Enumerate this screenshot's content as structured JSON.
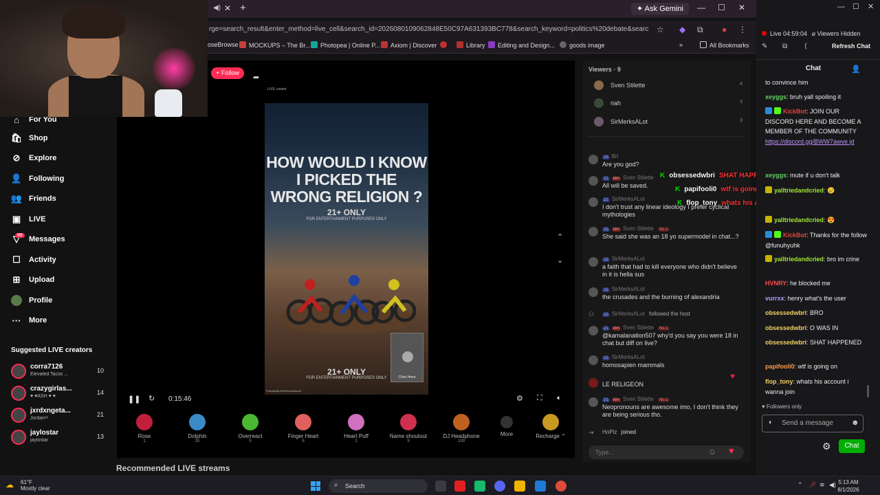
{
  "browser": {
    "url": "rge=search_result&enter_method=live_cell&search_id=2026080109062848E50C97A631393BC778&search_keyword=politics%20debate&search_result_id=…",
    "ask_gemini": "Ask Gemini",
    "bookmarks": [
      {
        "label": "oseBrowse",
        "color": "#444"
      },
      {
        "label": "MOCKUPS – The Br...",
        "color": "#c24040"
      },
      {
        "label": "Photopea | Online P...",
        "color": "#18a497"
      },
      {
        "label": "Axiom | Discover",
        "color": "#b83434"
      },
      {
        "label": "",
        "color": "#c03030"
      },
      {
        "label": "Library",
        "color": "#b03030"
      },
      {
        "label": "Editing and Design...",
        "color": "#8a3cc4"
      },
      {
        "label": "goods image",
        "color": "#666"
      }
    ],
    "all_bookmarks": "All Bookmarks"
  },
  "nav": {
    "items": [
      {
        "label": "For You",
        "icon": "home-icon"
      },
      {
        "label": "Shop",
        "icon": "shop-icon"
      },
      {
        "label": "Explore",
        "icon": "compass-icon"
      },
      {
        "label": "Following",
        "icon": "following-icon"
      },
      {
        "label": "Friends",
        "icon": "friends-icon"
      },
      {
        "label": "LIVE",
        "icon": "live-icon"
      },
      {
        "label": "Messages",
        "icon": "messages-icon"
      },
      {
        "label": "Activity",
        "icon": "activity-icon"
      },
      {
        "label": "Upload",
        "icon": "upload-icon"
      },
      {
        "label": "Profile",
        "icon": "profile-icon"
      },
      {
        "label": "More",
        "icon": "more-icon"
      }
    ],
    "messages_badge": "88",
    "suggested_title": "Suggested LIVE creators",
    "creators": [
      {
        "name": "corra7126",
        "sub": "Elevated Tacos ...",
        "count": "10"
      },
      {
        "name": "crazygirlas...",
        "sub": "♥ ♥ASH ♥ ♥",
        "count": "14"
      },
      {
        "name": "jxrdxngeta...",
        "sub": "Jxrdanᵛᵃ",
        "count": "21"
      },
      {
        "name": "jaylostar",
        "sub": "jaylostar",
        "count": "13"
      }
    ]
  },
  "live": {
    "follow": "+ Follow",
    "top_label": "LIVE creator",
    "title": "HOW WOULD I KNOW I PICKED THE WRONG RELIGION ?",
    "age_note": "21+ ONLY",
    "disclaimer": "FOR ENTERTAINMENT PURPOSES ONLY",
    "age_note_bottom": "21+ ONLY",
    "disclaimer_bottom": "FOR ENTERTAINMENT PURPOSES ONLY",
    "guest_name": "Chris Hmm",
    "watermark": "ProbablyButYesProductions1",
    "time": "0:15:46",
    "recommended": "Recommended LIVE streams"
  },
  "gifts": [
    {
      "name": "Rose",
      "price": "1",
      "color": "#c0203a"
    },
    {
      "name": "Dolphin",
      "price": "10",
      "color": "#3a8ac8"
    },
    {
      "name": "Overreact",
      "price": "5",
      "color": "#4ab830"
    },
    {
      "name": "Finger Heart",
      "price": "5",
      "color": "#e06060"
    },
    {
      "name": "Heart Puff",
      "price": "1",
      "color": "#d070c0"
    },
    {
      "name": "Name shoutout",
      "price": "5",
      "color": "#d03050"
    },
    {
      "name": "DJ Headphone",
      "price": "100",
      "color": "#c06020"
    }
  ],
  "gift_more": "More",
  "recharge": "Recharge ⌃",
  "viewers": {
    "title": "Viewers · 9",
    "list": [
      {
        "name": "Sven Stilette",
        "count": "4"
      },
      {
        "name": "riah",
        "count": "3"
      },
      {
        "name": "SirMerksALot",
        "count": "3"
      }
    ]
  },
  "live_chat": [
    {
      "level": "23",
      "user": "Bri",
      "text": "Are you god?"
    },
    {
      "level": "21",
      "tag": "klm",
      "user": "Sven Stilette",
      "text": "All will be saved."
    },
    {
      "level": "22",
      "user": "SirMerksALot",
      "text": "I don't trust any linear ideology I prefer cyclical mythologies"
    },
    {
      "level": "21",
      "tag": "klm",
      "user": "Sven Stilette",
      "rank": "No.1",
      "text": "She said she was an 18 yo supermodel in chat...?"
    },
    {
      "level": "22",
      "user": "SirMerksALot",
      "text": "a faith that had to kill everyone who didn't believe in it is hella sus"
    },
    {
      "level": "22",
      "user": "SirMerksALot",
      "text": "the crusades and the burning of alexandria"
    },
    {
      "level": "22",
      "user": "SirMerksALot",
      "text": "followed the host"
    },
    {
      "level": "21",
      "tag": "klm",
      "user": "Sven Stilette",
      "rank": "No.1",
      "text": "@kamalanation507 why'd you say you were 18 in chat but diff on live?"
    },
    {
      "level": "22",
      "user": "SirMerksALot",
      "text": "homosapien mammals"
    },
    {
      "user": "",
      "text": "LE RELIGEON"
    },
    {
      "level": "21",
      "tag": "klm",
      "user": "Sven Stilette",
      "rank": "No.1",
      "text": "Neopronouns are awesome imo, I don't think they are being serious tho."
    },
    {
      "user": "HoPlz",
      "text": "joined"
    }
  ],
  "type_placeholder": "Type...",
  "overlay_msgs": [
    {
      "name": "obsessedwbri",
      "msg": "SHAT HAPPENED"
    },
    {
      "name": "papifooli0",
      "msg": "wtf is going on"
    },
    {
      "name": "flop_tony",
      "msg": "whats his account i wanna join"
    }
  ],
  "dock": {
    "live_time": "Live 04:59:04",
    "viewers_hidden": "Viewers Hidden",
    "refresh": "Refresh Chat",
    "chat_title": "Chat",
    "followers_only": "Followers only",
    "send_placeholder": "Send a message",
    "chat_button": "Chat",
    "messages": [
      {
        "user": "",
        "text": "to convince him",
        "color": "#eee"
      },
      {
        "user": "xeyggs",
        "text": ": bruh yall spoiling it",
        "color": "#5fd35f"
      },
      {
        "user": "KickBot",
        "text": ": JOIN OUR DISCORD HERE AND BECOME A MEMBER OF THE COMMUNITY",
        "link": "https://discord.gg/BWW7awve jd",
        "color": "#e8413c",
        "badges": [
          "#2a8cd6",
          "#53fc18"
        ]
      },
      {
        "user": "xeyggs",
        "text": ": mute if u don't talk",
        "color": "#5fd35f"
      },
      {
        "user": "yalltriedandcried",
        "text": ": 😢",
        "color": "#a3e635",
        "badges": [
          "#c8b400"
        ]
      },
      {
        "user": "yalltriedandcried",
        "text": ": 😍",
        "color": "#a3e635",
        "badges": [
          "#c8b400"
        ]
      },
      {
        "user": "KickBot",
        "text": ": Thanks for the follow @funuhyuhk",
        "color": "#e8413c",
        "badges": [
          "#2a8cd6",
          "#53fc18"
        ]
      },
      {
        "user": "yalltriedandcried",
        "text": ": bro im crine",
        "color": "#a3e635",
        "badges": [
          "#c8b400"
        ]
      },
      {
        "user": "HVNRY",
        "text": ": he blocked me",
        "color": "#ff4a4a"
      },
      {
        "user": "vurrxx",
        "text": ": henry what's the user",
        "color": "#b69cff"
      },
      {
        "user": "obsessedwbri",
        "text": ": BRO",
        "color": "#f5d060"
      },
      {
        "user": "obsessedwbri",
        "text": ": O WAS IN",
        "color": "#f5d060"
      },
      {
        "user": "obsessedwbri",
        "text": ": SHAT HAPPENED",
        "color": "#f5d060"
      },
      {
        "user": "papifooli0",
        "text": ": wtf is going on",
        "color": "#ff9a4a"
      },
      {
        "user": "flop_tony",
        "text": ": whats his account i wanna join",
        "color": "#f5d060"
      }
    ]
  },
  "taskbar": {
    "temp": "61°F",
    "weather": "Mostly clear",
    "search": "Search",
    "time": "5:13 AM",
    "date": "8/1/2026"
  }
}
